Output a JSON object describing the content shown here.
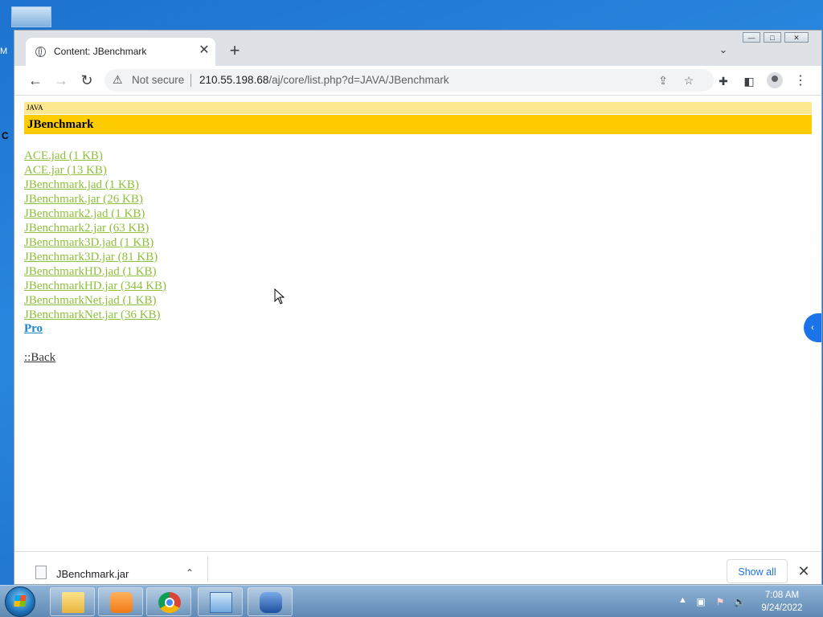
{
  "desktop": {
    "edge_letter": "M",
    "edge_letter2": "C"
  },
  "window_controls": {
    "minimize": "—",
    "maximize": "□",
    "close": "✕"
  },
  "tab": {
    "title": "Content: JBenchmark",
    "close": "✕",
    "new_tab": "+",
    "tab_search": "⌄"
  },
  "toolbar": {
    "back": "←",
    "forward": "→",
    "reload": "↻",
    "security_icon": "warning-icon",
    "security_text": "Not secure",
    "url_host": "210.55.198.68",
    "url_path": "/aj/core/list.php?d=JAVA/JBenchmark",
    "share": "⇪",
    "bookmark": "☆",
    "extensions": "✚",
    "side_panel": "◧",
    "menu": "⋮"
  },
  "page": {
    "category": "JAVA",
    "title": "JBenchmark",
    "files": [
      "ACE.jad (1 KB)",
      "ACE.jar (13 KB)",
      "JBenchmark.jad (1 KB)",
      "JBenchmark.jar (26 KB)",
      "JBenchmark2.jad (1 KB)",
      "JBenchmark2.jar (63 KB)",
      "JBenchmark3D.jad (1 KB)",
      "JBenchmark3D.jar (81 KB)",
      "JBenchmarkHD.jad (1 KB)",
      "JBenchmarkHD.jar (344 KB)",
      "JBenchmarkNet.jad (1 KB)",
      "JBenchmarkNet.jar (36 KB)"
    ],
    "pro_link": "Pro",
    "back_link": "::Back",
    "side_tab": "‹"
  },
  "download_bar": {
    "file_name": "JBenchmark.jar",
    "caret": "⌃",
    "show_all": "Show all",
    "close": "✕"
  },
  "taskbar": {
    "apps": [
      "file-explorer",
      "media-player",
      "chrome",
      "control-panel",
      "device-app"
    ],
    "clock_time": "7:08 AM",
    "clock_date": "9/24/2022",
    "tray_arrow": "▲"
  },
  "colors": {
    "link_visited": "#8ebf3a",
    "pro_link": "#1e88c7",
    "title_bar": "#ffcc00",
    "category_bar": "#ffe990"
  }
}
